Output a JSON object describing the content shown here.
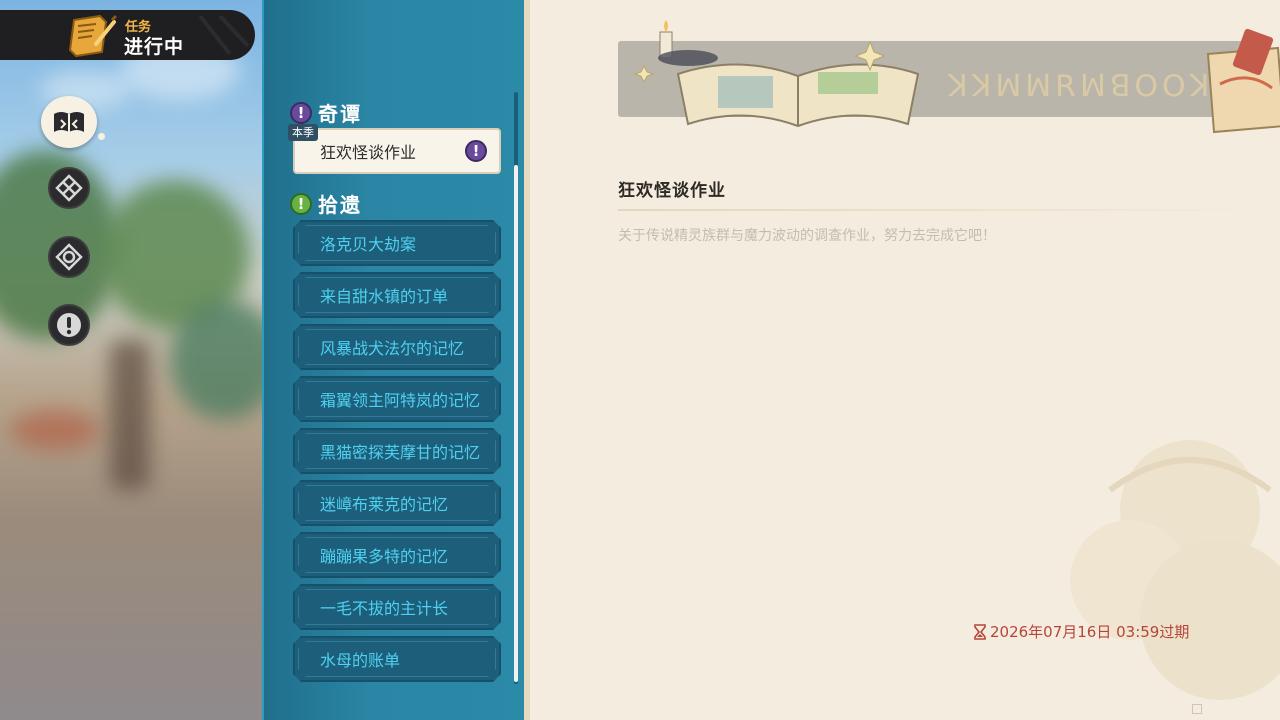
{
  "header": {
    "subtitle": "任务",
    "title": "进行中"
  },
  "sidebar": {
    "buttons": [
      {
        "icon": "quest-book-icon",
        "active": true
      },
      {
        "icon": "compass-emblem-icon",
        "active": false
      },
      {
        "icon": "gear-emblem-icon",
        "active": false
      },
      {
        "icon": "exclamation-icon",
        "active": false
      }
    ]
  },
  "quest_list": {
    "section_1": {
      "label": "奇谭",
      "icon": "purple-exclamation-icon"
    },
    "selected": {
      "tag": "本季",
      "label": "狂欢怪谈作业",
      "icon": "purple-exclamation-icon"
    },
    "section_2": {
      "label": "拾遗",
      "icon": "green-exclamation-icon"
    },
    "items": [
      "洛克贝大劫案",
      "来自甜水镇的订单",
      "风暴战犬法尔的记忆",
      "霜翼领主阿特岚的记忆",
      "黑猫密探芙摩甘的记忆",
      "迷嶂布莱克的记忆",
      "蹦蹦果多特的记忆",
      "一毛不拔的主计长",
      "水母的账单"
    ]
  },
  "detail": {
    "title": "狂欢怪谈作业",
    "description": "关于传说精灵族群与魔力波动的调查作业，努力去完成它吧！",
    "expire_text": "2026年07月16日 03:59过期"
  },
  "colors": {
    "panel_blue": "#2a86a4",
    "item_text": "#4fd0ef",
    "accent_gold": "#f1b54a",
    "expire_red": "#b7443b"
  }
}
